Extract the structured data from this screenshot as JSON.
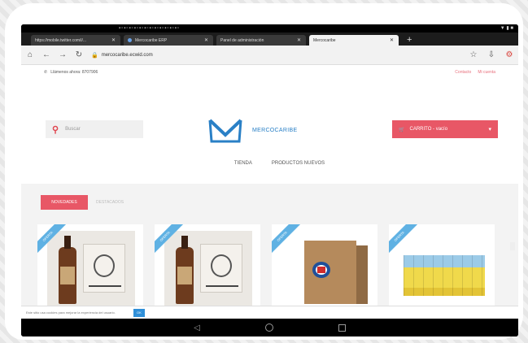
{
  "browser": {
    "tabs": [
      {
        "label": "https://mobile.twitter.com/i/..."
      },
      {
        "label": "Mercocaribe ERP"
      },
      {
        "label": "Panel de administración"
      },
      {
        "label": "Mercocaribe",
        "active": true
      }
    ],
    "url": "mercocaribe.ecwid.com"
  },
  "site": {
    "phone_label": "Llámenos ahora: 8707906",
    "top_links": [
      "Contacto",
      "Mi cuenta"
    ],
    "search_placeholder": "Buscar",
    "logo_text": "MERCOCARIBE",
    "cart_label": "CARRITO - vacío",
    "nav": [
      "TIENDA",
      "PRODUCTOS NUEVOS"
    ],
    "product_tabs": [
      "NOVEDADES",
      "DESTACADOS"
    ],
    "ribbon": "OFERTA",
    "products": [
      {
        "image": "rum-bottle-box"
      },
      {
        "image": "rum-bottle-box"
      },
      {
        "image": "beer-carton"
      },
      {
        "image": "soda-cans-pack"
      }
    ],
    "cookie_text": "Este sitio usa cookies para mejorar la experiencia del usuario.",
    "cookie_ok": "OK"
  },
  "colors": {
    "accent": "#e85766",
    "ribbon": "#5fb1e3",
    "logo": "#2a80c6"
  }
}
